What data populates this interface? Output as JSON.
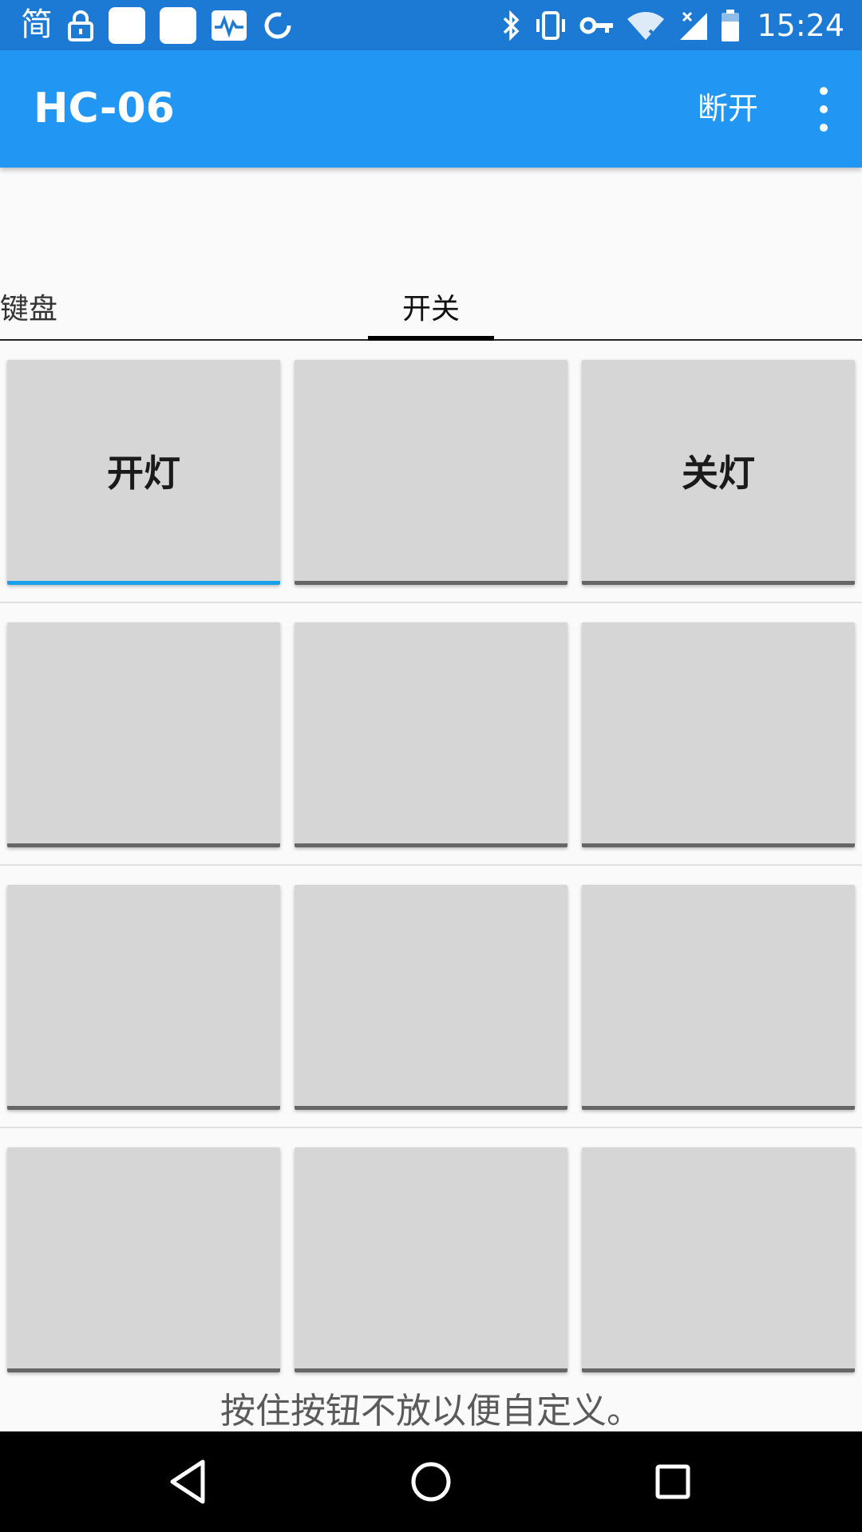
{
  "status_bar": {
    "left_char": "简",
    "time": "15:24",
    "icons": [
      "lock-icon",
      "app-square-icon",
      "app-square-icon",
      "activity-icon",
      "sync-icon",
      "bluetooth-icon",
      "vibrate-icon",
      "vpn-key-icon",
      "wifi-icon",
      "signal-icon",
      "battery-icon"
    ]
  },
  "app_bar": {
    "title": "HC-06",
    "action_label": "断开",
    "background": "#2196f3"
  },
  "tabs": [
    {
      "label": "键盘",
      "selected": false
    },
    {
      "label": "开关",
      "selected": true
    }
  ],
  "grid": {
    "rows": [
      [
        {
          "label": "开灯",
          "active": true
        },
        {
          "label": ""
        },
        {
          "label": "关灯"
        }
      ],
      [
        {
          "label": ""
        },
        {
          "label": ""
        },
        {
          "label": ""
        }
      ],
      [
        {
          "label": ""
        },
        {
          "label": ""
        },
        {
          "label": ""
        }
      ],
      [
        {
          "label": ""
        },
        {
          "label": ""
        },
        {
          "label": ""
        }
      ]
    ],
    "active_accent": "#1aa0ea"
  },
  "hint": "按住按钮不放以便自定义。",
  "nav_bar": {
    "buttons": [
      "back-icon",
      "home-icon",
      "recent-apps-icon"
    ]
  }
}
